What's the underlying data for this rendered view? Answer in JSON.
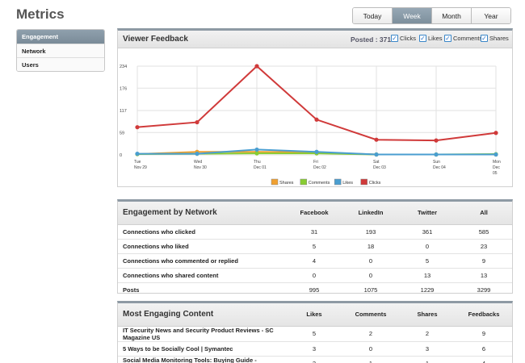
{
  "page_title": "Metrics",
  "ranges": [
    {
      "label": "Today",
      "active": false
    },
    {
      "label": "Week",
      "active": true
    },
    {
      "label": "Month",
      "active": false
    },
    {
      "label": "Year",
      "active": false
    }
  ],
  "sidebar": {
    "items": [
      {
        "label": "Engagement",
        "active": true
      },
      {
        "label": "Network",
        "active": false
      },
      {
        "label": "Users",
        "active": false
      }
    ]
  },
  "viewer_feedback": {
    "title": "Viewer Feedback",
    "posted": "Posted : 371",
    "toggles": [
      {
        "label": "Clicks",
        "checked": true
      },
      {
        "label": "Likes",
        "checked": true
      },
      {
        "label": "Comments",
        "checked": true
      },
      {
        "label": "Shares",
        "checked": true
      }
    ]
  },
  "chart_data": {
    "type": "line",
    "y_ticks": [
      "234",
      "176",
      "117",
      "59",
      "0"
    ],
    "ylim": [
      0,
      234
    ],
    "categories": [
      [
        "Tue",
        "Nov 29"
      ],
      [
        "Wed",
        "Nov 30"
      ],
      [
        "Thu",
        "Dec 01"
      ],
      [
        "Fri",
        "Dec 02"
      ],
      [
        "Sat",
        "Dec 03"
      ],
      [
        "Sun",
        "Dec 04"
      ],
      [
        "Mon",
        "Dec",
        "05"
      ]
    ],
    "series": [
      {
        "name": "Shares",
        "color": "#f0a030",
        "values": [
          2,
          8,
          8,
          7,
          1,
          1,
          1
        ]
      },
      {
        "name": "Comments",
        "color": "#88cc33",
        "values": [
          2,
          3,
          4,
          4,
          1,
          1,
          2
        ]
      },
      {
        "name": "Likes",
        "color": "#4a9ed0",
        "values": [
          3,
          3,
          14,
          8,
          1,
          1,
          1
        ]
      },
      {
        "name": "Clicks",
        "color": "#d03a3a",
        "values": [
          73,
          86,
          234,
          93,
          40,
          38,
          58
        ]
      }
    ],
    "legend": "bottom"
  },
  "engagement": {
    "title": "Engagement by Network",
    "columns": [
      "Facebook",
      "LinkedIn",
      "Twitter",
      "All"
    ],
    "rows": [
      {
        "label": "Connections who clicked",
        "values": [
          "31",
          "193",
          "361",
          "585"
        ]
      },
      {
        "label": "Connections who liked",
        "values": [
          "5",
          "18",
          "0",
          "23"
        ]
      },
      {
        "label": "Connections who commented or replied",
        "values": [
          "4",
          "0",
          "5",
          "9"
        ]
      },
      {
        "label": "Connections who shared content",
        "values": [
          "0",
          "0",
          "13",
          "13"
        ]
      },
      {
        "label": "Posts",
        "values": [
          "995",
          "1075",
          "1229",
          "3299"
        ]
      }
    ]
  },
  "content": {
    "title": "Most Engaging Content",
    "columns": [
      "Likes",
      "Comments",
      "Shares",
      "Feedbacks"
    ],
    "rows": [
      {
        "label": "IT Security News and Security Product Reviews - SC Magazine US",
        "values": [
          "5",
          "2",
          "2",
          "9"
        ]
      },
      {
        "label": "5 Ways to be Socially Cool | Symantec",
        "values": [
          "3",
          "0",
          "3",
          "6"
        ]
      },
      {
        "label": "Social Media Monitoring Tools: Buying Guide - Datamation",
        "values": [
          "2",
          "1",
          "1",
          "4"
        ]
      }
    ]
  }
}
